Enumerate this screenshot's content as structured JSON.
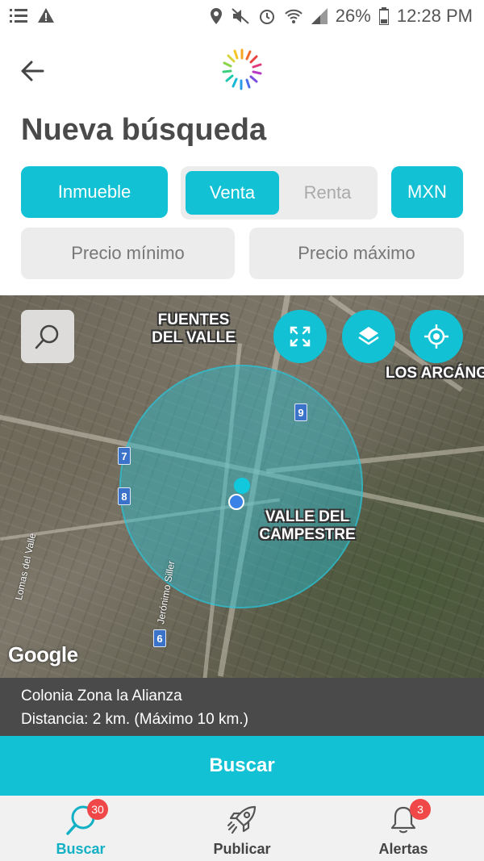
{
  "status_bar": {
    "battery": "26%",
    "time": "12:28 PM"
  },
  "header": {
    "title": "Nueva búsqueda"
  },
  "filters": {
    "property_type": "Inmueble",
    "operation_selected": "Venta",
    "operation_other": "Renta",
    "currency": "MXN",
    "price_min_placeholder": "Precio mínimo",
    "price_max_placeholder": "Precio máximo"
  },
  "map": {
    "labels": {
      "fuentes": "FUENTES\nDEL VALLE",
      "arcangeles": "LOS ARCÁNG",
      "valle": "VALLE DEL\nCAMPESTRE"
    },
    "streets": {
      "lomas": "Lomas del Valle",
      "jeronimo": "Jerónimo Siller"
    },
    "markers": [
      "9",
      "7",
      "8",
      "6"
    ],
    "attribution": "Google"
  },
  "location": {
    "name": "Colonia Zona la Alianza",
    "distance": "Distancia: 2 km. (Máximo 10 km.)"
  },
  "actions": {
    "search": "Buscar"
  },
  "bottom_nav": {
    "items": [
      {
        "label": "Buscar",
        "badge": "30"
      },
      {
        "label": "Publicar"
      },
      {
        "label": "Alertas",
        "badge": "3"
      }
    ]
  },
  "colors": {
    "accent": "#12c2d4",
    "badge": "#f04848",
    "info_bar": "#4a4a4a"
  }
}
